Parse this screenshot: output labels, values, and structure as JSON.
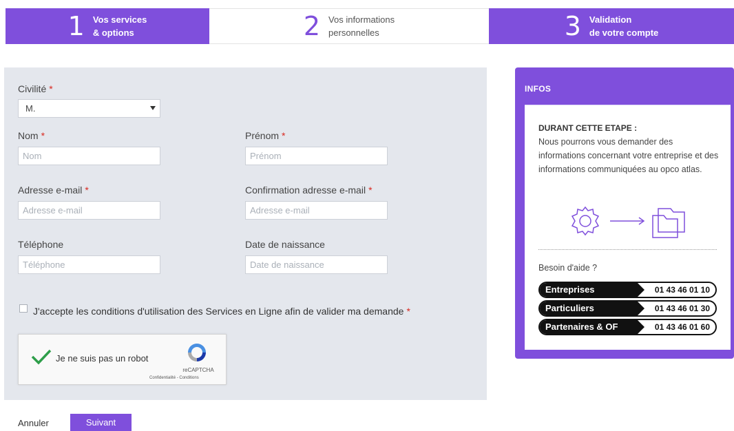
{
  "steps": [
    {
      "number": "1",
      "line1": "Vos services",
      "line2": "& options"
    },
    {
      "number": "2",
      "line1": "Vos informations",
      "line2": "personnelles"
    },
    {
      "number": "3",
      "line1": "Validation",
      "line2": "de votre compte"
    }
  ],
  "form": {
    "civility": {
      "label": "Civilité",
      "value": "M."
    },
    "nom": {
      "label": "Nom",
      "placeholder": "Nom"
    },
    "prenom": {
      "label": "Prénom",
      "placeholder": "Prénom"
    },
    "email": {
      "label": "Adresse e-mail",
      "placeholder": "Adresse e-mail"
    },
    "email_confirm": {
      "label": "Confirmation adresse e-mail",
      "placeholder": "Adresse e-mail"
    },
    "phone": {
      "label": "Téléphone",
      "placeholder": "Téléphone"
    },
    "birthdate": {
      "label": "Date de naissance",
      "placeholder": "Date de naissance"
    },
    "required_mark": "*",
    "terms": "J'accepte les conditions d'utilisation des Services en Ligne afin de valider ma demande"
  },
  "recaptcha": {
    "label": "Je ne suis pas un robot",
    "brand": "reCAPTCHA",
    "links": "Confidentialité - Conditions"
  },
  "actions": {
    "cancel": "Annuler",
    "next": "Suivant"
  },
  "info": {
    "title": "INFOS",
    "heading": "DURANT CETTE ETAPE :",
    "body": "Nous pourrons vous demander des informations concernant votre entreprise et des informations communiquées au opco atlas.",
    "help": "Besoin d'aide ?",
    "contacts": [
      {
        "name": "Entreprises",
        "phone": "01 43 46 01 10"
      },
      {
        "name": "Particuliers",
        "phone": "01 43 46 01 30"
      },
      {
        "name": "Partenaires & OF",
        "phone": "01 43 46 01 60"
      }
    ]
  },
  "colors": {
    "accent": "#7f4fdc",
    "required": "#d9281f",
    "panel": "#e4e7ed"
  }
}
